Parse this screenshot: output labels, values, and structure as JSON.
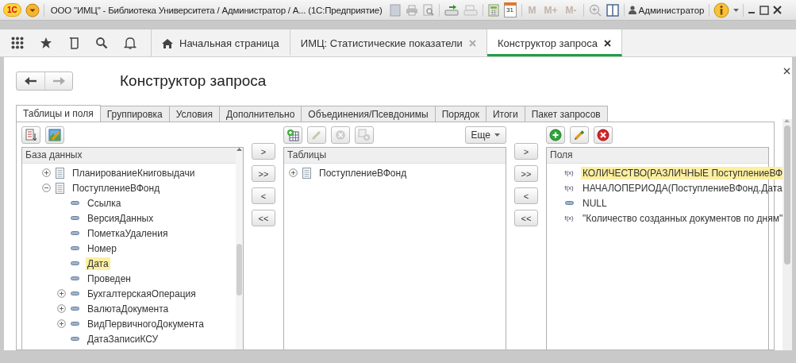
{
  "window": {
    "logo": "1С",
    "title": "ООО \"ИМЦ\" - Библиотека Университета / Администратор / А... (1С:Предприятие)",
    "calendar_day": "31",
    "memory_buttons": [
      "M",
      "M+",
      "M-"
    ],
    "user": "Администратор"
  },
  "open_tabs": [
    {
      "kind": "home",
      "label": "Начальная страница",
      "selected": false
    },
    {
      "kind": "closable",
      "label": "ИМЦ: Статистические показатели",
      "selected": false
    },
    {
      "kind": "closable",
      "label": "Конструктор запроса",
      "selected": true
    }
  ],
  "form": {
    "title": "Конструктор запроса"
  },
  "tabs": [
    {
      "label": "Таблицы и поля",
      "selected": true
    },
    {
      "label": "Группировка",
      "selected": false
    },
    {
      "label": "Условия",
      "selected": false
    },
    {
      "label": "Дополнительно",
      "selected": false
    },
    {
      "label": "Объединения/Псевдонимы",
      "selected": false
    },
    {
      "label": "Порядок",
      "selected": false
    },
    {
      "label": "Итоги",
      "selected": false
    },
    {
      "label": "Пакет запросов",
      "selected": false
    }
  ],
  "database": {
    "header": "База данных",
    "items": [
      {
        "kind": "table",
        "label": "ПланированиеКниговыдачи",
        "expanded": false,
        "selected": false
      },
      {
        "kind": "table",
        "label": "ПоступлениеВФонд",
        "expanded": true,
        "selected": false,
        "children": [
          {
            "kind": "field",
            "label": "Ссылка",
            "selected": false
          },
          {
            "kind": "field",
            "label": "ВерсияДанных",
            "selected": false
          },
          {
            "kind": "field",
            "label": "ПометкаУдаления",
            "selected": false
          },
          {
            "kind": "field",
            "label": "Номер",
            "selected": false
          },
          {
            "kind": "field",
            "label": "Дата",
            "selected": true
          },
          {
            "kind": "field",
            "label": "Проведен",
            "selected": false
          },
          {
            "kind": "field",
            "label": "БухгалтерскаяОперация",
            "expanded": false,
            "selected": false
          },
          {
            "kind": "field",
            "label": "ВалютаДокумента",
            "expanded": false,
            "selected": false
          },
          {
            "kind": "field",
            "label": "ВидПервичногоДокумента",
            "expanded": false,
            "selected": false
          },
          {
            "kind": "field",
            "label": "ДатаЗаписиКСУ",
            "selected": false
          }
        ]
      }
    ]
  },
  "left_move_buttons": [
    ">",
    ">>",
    "<",
    "<<"
  ],
  "tables": {
    "header": "Таблицы",
    "more_button": "Еще",
    "items": [
      {
        "kind": "table",
        "label": "ПоступлениеВФонд",
        "expanded": false,
        "selected": false
      }
    ]
  },
  "right_move_buttons": [
    ">",
    ">>",
    "<",
    "<<"
  ],
  "fields": {
    "header": "Поля",
    "items": [
      {
        "kind": "expression",
        "glyph": "f(x)",
        "label": "КОЛИЧЕСТВО(РАЗЛИЧНЫЕ ПоступлениеВФ",
        "selected": true
      },
      {
        "kind": "expression",
        "glyph": "f(x)",
        "label": "НАЧАЛОПЕРИОДА(ПоступлениеВФонд.Дата",
        "selected": false
      },
      {
        "kind": "field",
        "label": "NULL",
        "selected": false
      },
      {
        "kind": "expression",
        "glyph": "f(x)",
        "label": "\"Количество созданных документов по дням\"",
        "selected": false
      }
    ]
  }
}
